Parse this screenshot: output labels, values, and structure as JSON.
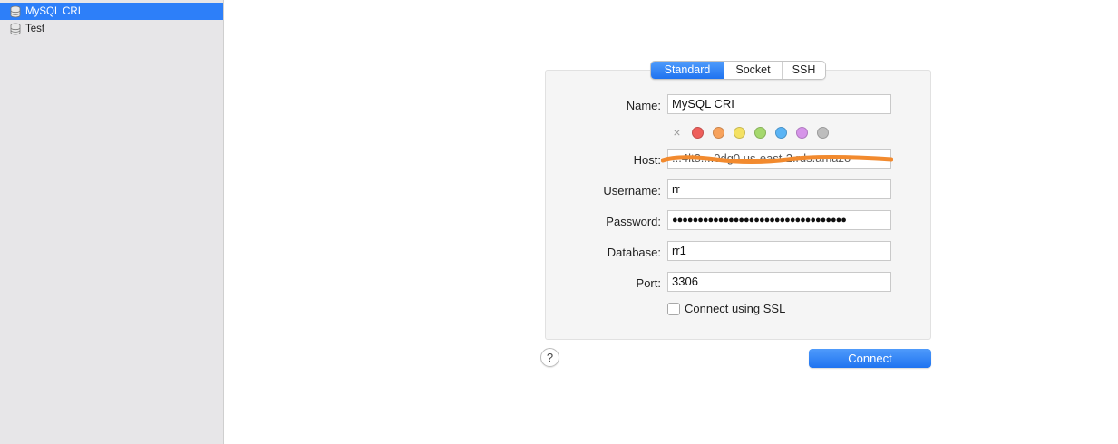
{
  "sidebar": {
    "favorites": [
      {
        "label": "MySQL CRI",
        "selected": true,
        "icon": "database-icon"
      },
      {
        "label": "Test",
        "selected": false,
        "icon": "database-icon"
      }
    ]
  },
  "connection_types": {
    "tabs": [
      {
        "label": "Standard",
        "active": true
      },
      {
        "label": "Socket",
        "active": false
      },
      {
        "label": "SSH",
        "active": false
      }
    ]
  },
  "form": {
    "name_label": "Name:",
    "name_value": "MySQL CRI",
    "host_label": "Host:",
    "host_value": "...4lt8....0dg0.us-east-2.rds.amazo",
    "username_label": "Username:",
    "username_value": "rr",
    "password_label": "Password:",
    "password_value": "●●●●●●●●●●●●●●●●●●●●●●●●●●●●●●●●●●",
    "database_label": "Database:",
    "database_value": "rr1",
    "port_label": "Port:",
    "port_value": "3306",
    "ssl_label": "Connect using SSL",
    "ssl_checked": false
  },
  "color_labels": {
    "clear_icon": "×",
    "colors": [
      "#ee5f5b",
      "#f7a25c",
      "#f4e163",
      "#a5d86d",
      "#5ab4f5",
      "#d694e9",
      "#bdbdbd"
    ]
  },
  "host_redaction_color": "#f28a2e",
  "actions": {
    "help_label": "?",
    "connect_label": "Connect"
  }
}
